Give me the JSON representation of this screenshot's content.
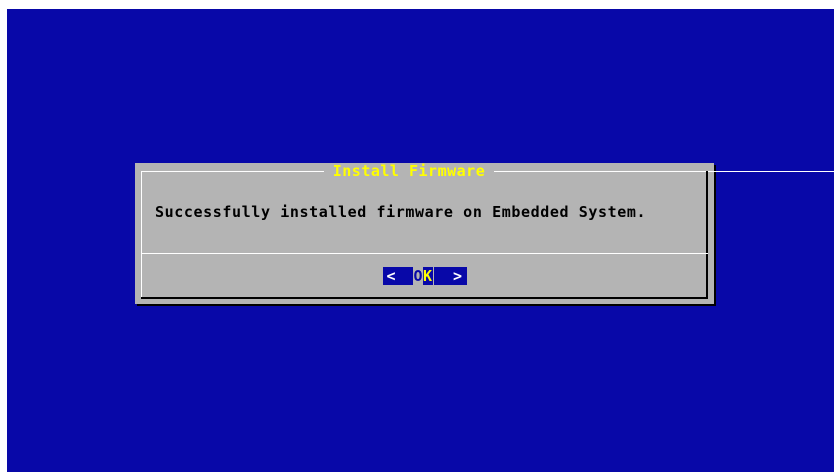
{
  "dialog": {
    "title": "Install Firmware",
    "message": "Successfully installed firmware on Embedded System.",
    "ok_button": {
      "bracket_left": "<",
      "label_first": "O",
      "label_rest": "K",
      "bracket_right": ">"
    }
  },
  "colors": {
    "screen_background": "#0808a8",
    "dialog_background": "#b4b4b4",
    "title_text": "#ffff00",
    "message_text": "#000000",
    "button_background": "#0808a8"
  }
}
